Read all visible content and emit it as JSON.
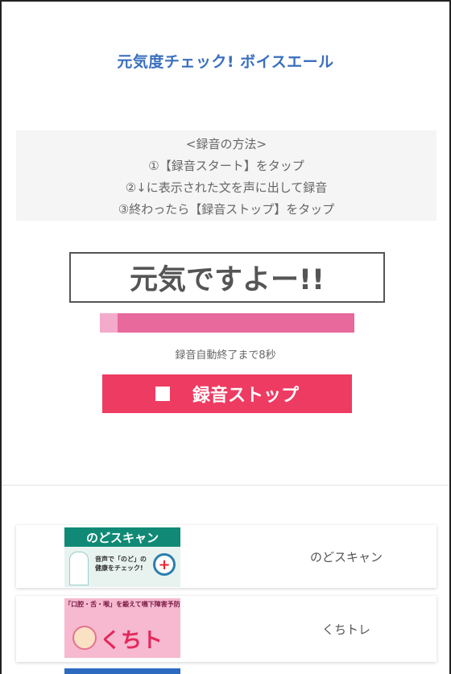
{
  "header": {
    "title": "元気度チェック! ボイスエール"
  },
  "instructions": {
    "heading": "<録音の方法>",
    "steps": [
      "①【録音スタート】をタップ",
      "②↓に表示された文を声に出して録音",
      "③終わったら【録音ストップ】をタップ"
    ]
  },
  "phrase": {
    "text": "元気ですよー!!"
  },
  "progress": {
    "fraction": 0.07,
    "track_color": "#e8699b",
    "fill_color": "#f3aacb"
  },
  "countdown": {
    "text": "録音自動終了まで8秒"
  },
  "stop_button": {
    "label": "録音ストップ",
    "color": "#ee3b62",
    "icon": "stop-icon"
  },
  "apps": [
    {
      "name": "のどスキャン",
      "thumb_title": "のどスキャン",
      "thumb_text": "音声で「のど」の健康をチェック!",
      "thumb_icon": "magnifier-icon"
    },
    {
      "name": "くちトレ",
      "thumb_title": "「口腔・舌・喉」を鍛えて嚥下障害予防",
      "thumb_big": "くちトレ",
      "thumb_icon": "face-icon"
    }
  ]
}
